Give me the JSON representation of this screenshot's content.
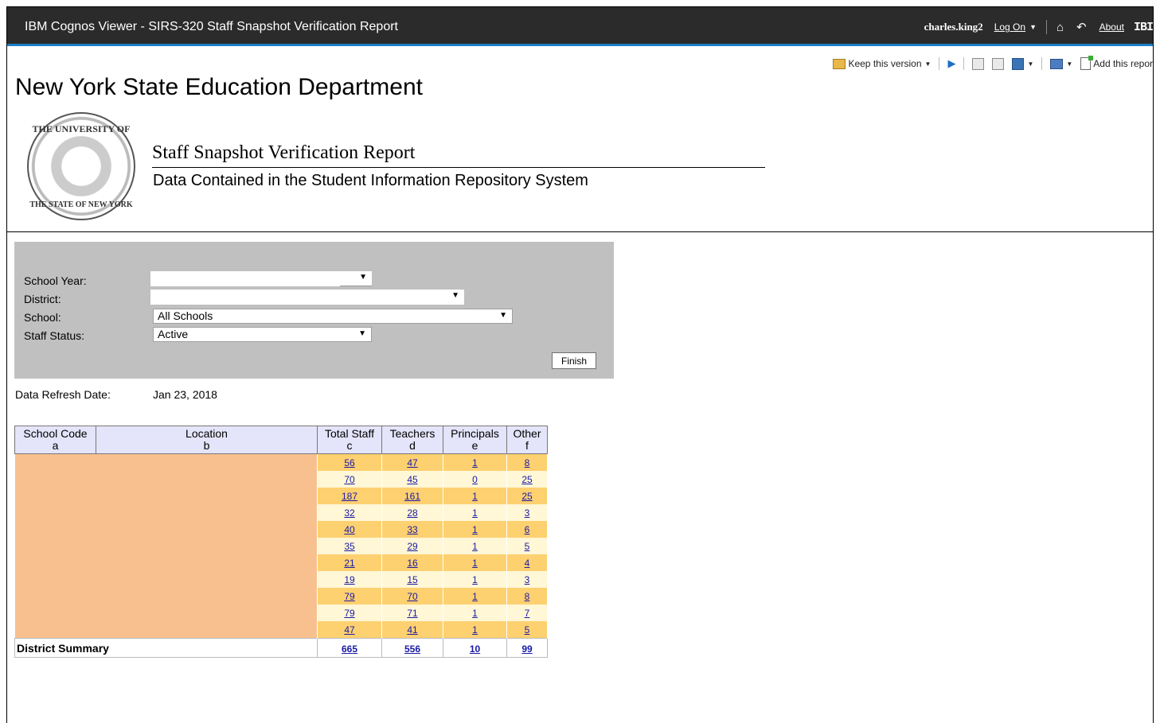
{
  "titlebar": {
    "title": "IBM Cognos Viewer - SIRS-320 Staff Snapshot Verification Report",
    "user": "charles.king2",
    "log_on": "Log On",
    "about": "About",
    "brand": "IBI"
  },
  "toolbar": {
    "keep_version": "Keep this version",
    "add_report": "Add this repor"
  },
  "header": {
    "org": "New York State Education Department",
    "seal_top": "THE UNIVERSITY OF",
    "seal_bottom": "THE STATE OF NEW YORK",
    "report_title": "Staff Snapshot Verification Report",
    "report_subtitle": "Data Contained in the Student Information Repository System"
  },
  "prompts": {
    "school_year_label": "School Year:",
    "school_year_value": "",
    "district_label": "District:",
    "district_value": "",
    "school_label": "School:",
    "school_value": "All Schools",
    "staff_status_label": "Staff Status:",
    "staff_status_value": "Active",
    "finish": "Finish"
  },
  "refresh": {
    "label": "Data Refresh Date:",
    "value": "Jan 23, 2018"
  },
  "table": {
    "headers": [
      {
        "title": "School Code",
        "letter": "a"
      },
      {
        "title": "Location",
        "letter": "b"
      },
      {
        "title": "Total Staff",
        "letter": "c"
      },
      {
        "title": "Teachers",
        "letter": "d"
      },
      {
        "title": "Principals",
        "letter": "e"
      },
      {
        "title": "Other",
        "letter": "f"
      }
    ],
    "rows": [
      {
        "total": "56",
        "teachers": "47",
        "principals": "1",
        "other": "8"
      },
      {
        "total": "70",
        "teachers": "45",
        "principals": "0",
        "other": "25"
      },
      {
        "total": "187",
        "teachers": "161",
        "principals": "1",
        "other": "25"
      },
      {
        "total": "32",
        "teachers": "28",
        "principals": "1",
        "other": "3"
      },
      {
        "total": "40",
        "teachers": "33",
        "principals": "1",
        "other": "6"
      },
      {
        "total": "35",
        "teachers": "29",
        "principals": "1",
        "other": "5"
      },
      {
        "total": "21",
        "teachers": "16",
        "principals": "1",
        "other": "4"
      },
      {
        "total": "19",
        "teachers": "15",
        "principals": "1",
        "other": "3"
      },
      {
        "total": "79",
        "teachers": "70",
        "principals": "1",
        "other": "8"
      },
      {
        "total": "79",
        "teachers": "71",
        "principals": "1",
        "other": "7"
      },
      {
        "total": "47",
        "teachers": "41",
        "principals": "1",
        "other": "5"
      }
    ],
    "summary": {
      "label": "District Summary",
      "total": "665",
      "teachers": "556",
      "principals": "10",
      "other": "99"
    }
  }
}
